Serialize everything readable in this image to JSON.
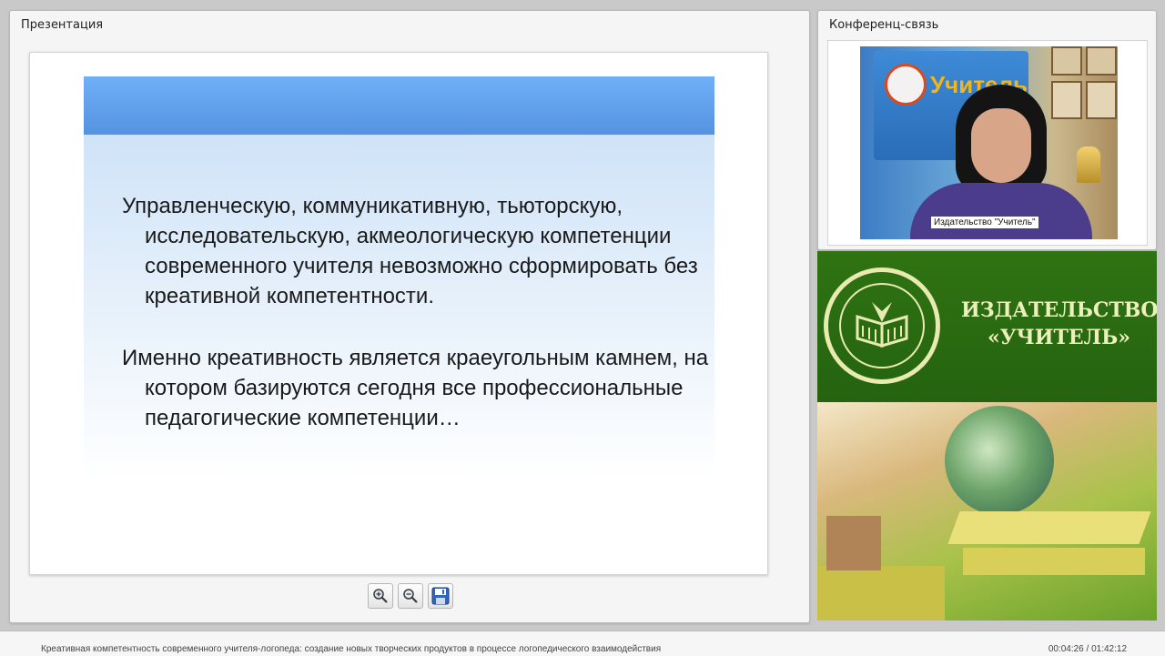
{
  "presentation": {
    "title": "Презентация",
    "slide": {
      "paragraph1": "Управленческую, коммуникативную, тьюторскую, исследовательскую, акмеологическую компетенции современного учителя невозможно сформировать без креативной компетентности.",
      "paragraph2": "Именно креативность является краеугольным камнем, на котором базируются сегодня все профессиональные педагогические компетенции…"
    },
    "toolbar": [
      {
        "name": "zoom-in",
        "icon": "zoom-in-icon"
      },
      {
        "name": "zoom-out",
        "icon": "zoom-out-icon"
      },
      {
        "name": "save",
        "icon": "save-icon"
      }
    ]
  },
  "conference": {
    "title": "Конференц-связь",
    "video_caption": "Издательство \"Учитель\""
  },
  "publisher": {
    "title_line1": "ИЗДАТЕЛЬСТВО",
    "title_line2": "«УЧИТЕЛЬ»"
  },
  "status": {
    "webinar_title": "Креативная компетентность современного учителя-логопеда: создание новых творческих продуктов в процессе логопедического взаимодействия",
    "time": "00:04:26 / 01:42:12"
  },
  "colors": {
    "slide_header": "#5b98e6",
    "publisher_green": "#2c6a10",
    "publisher_text": "#eef0bb"
  }
}
